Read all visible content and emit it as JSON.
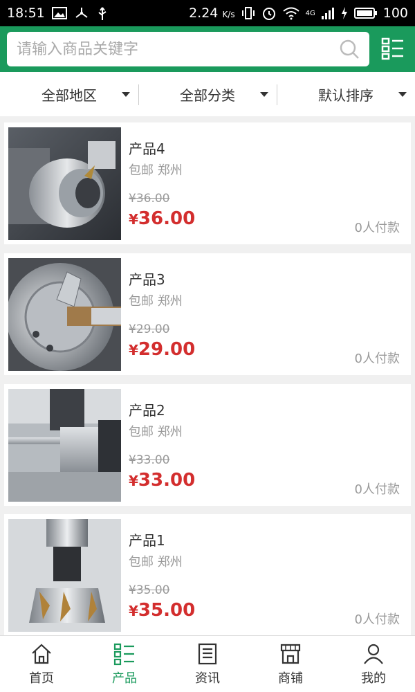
{
  "status": {
    "time": "18:51",
    "speed": "2.24",
    "speed_unit": "K/s",
    "battery": "100",
    "network": "4G"
  },
  "search": {
    "placeholder": "请输入商品关键字"
  },
  "filters": [
    {
      "label": "全部地区"
    },
    {
      "label": "全部分类"
    },
    {
      "label": "默认排序"
    }
  ],
  "products": [
    {
      "title": "产品4",
      "sub": "包邮 郑州",
      "old_price": "¥36.00",
      "currency": "¥",
      "price": "36.00",
      "paid": "0人付款"
    },
    {
      "title": "产品3",
      "sub": "包邮 郑州",
      "old_price": "¥29.00",
      "currency": "¥",
      "price": "29.00",
      "paid": "0人付款"
    },
    {
      "title": "产品2",
      "sub": "包邮 郑州",
      "old_price": "¥33.00",
      "currency": "¥",
      "price": "33.00",
      "paid": "0人付款"
    },
    {
      "title": "产品1",
      "sub": "包邮 郑州",
      "old_price": "¥35.00",
      "currency": "¥",
      "price": "35.00",
      "paid": "0人付款"
    }
  ],
  "tabs": [
    {
      "label": "首页",
      "icon": "home-icon"
    },
    {
      "label": "产品",
      "icon": "product-list-icon",
      "active": true
    },
    {
      "label": "资讯",
      "icon": "news-icon"
    },
    {
      "label": "商铺",
      "icon": "shop-icon"
    },
    {
      "label": "我的",
      "icon": "user-icon"
    }
  ],
  "colors": {
    "accent": "#1a9a5c",
    "price": "#d32e2e"
  }
}
